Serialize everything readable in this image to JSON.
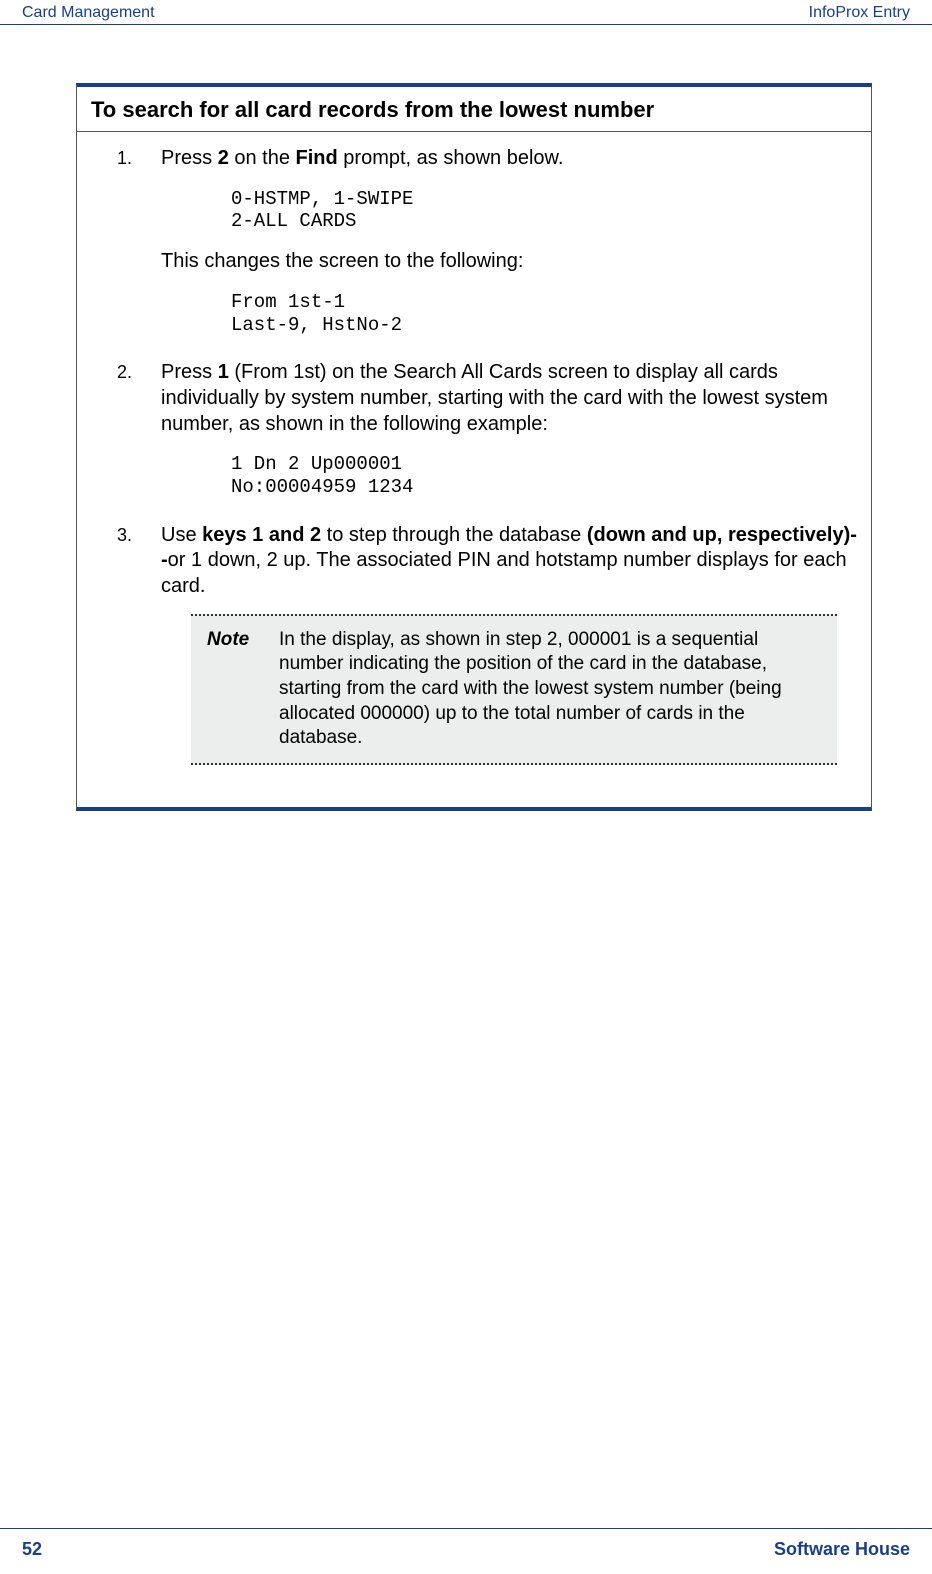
{
  "header": {
    "left": "Card Management",
    "right": "InfoProx Entry"
  },
  "proc": {
    "title": "To search for all card records from the lowest number",
    "steps": [
      {
        "num": "1.",
        "intro_pre": "Press ",
        "intro_b1": "2",
        "intro_mid": " on the ",
        "intro_b2": "Find",
        "intro_post": " prompt, as shown below.",
        "code1_l1": "0-HSTMP, 1-SWIPE",
        "code1_l2": "2-ALL CARDS",
        "mid": "This changes the screen to the following:",
        "code2_l1": "From 1st-1",
        "code2_l2": "Last-9, HstNo-2"
      },
      {
        "num": "2.",
        "intro_pre": "Press ",
        "intro_b1": "1",
        "intro_post": " (From 1st) on the Search All Cards screen to display all cards individually by system number, starting with the card with the lowest system number, as shown in the following example:",
        "code1_l1": "1 Dn 2 Up000001",
        "code1_l2": "No:00004959 1234"
      },
      {
        "num": "3.",
        "intro_pre": "Use ",
        "intro_b1": "keys 1 and 2",
        "intro_mid": " to step through the database ",
        "intro_b2": "(down and up, respectively)--",
        "intro_post": "or 1 down, 2 up. The associated PIN and hotstamp number displays for each card."
      }
    ],
    "note_label": "Note",
    "note_text": "In the display, as shown in step 2, 000001 is a sequential number indicating the position of the card in the database, starting from the card with the lowest system number (being allocated 000000) up to the total number of cards in the database."
  },
  "footer": {
    "page": "52",
    "brand": "Software House"
  }
}
